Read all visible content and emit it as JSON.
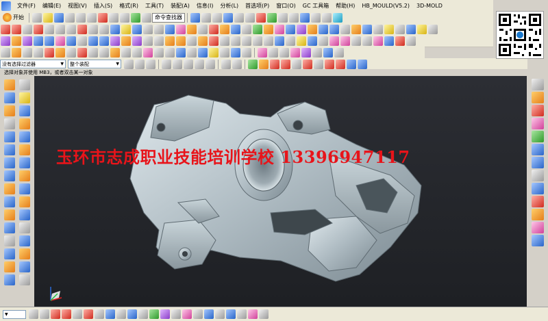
{
  "menu": {
    "items": [
      "文件(F)",
      "编辑(E)",
      "视图(V)",
      "插入(S)",
      "格式(R)",
      "工具(T)",
      "装配(A)",
      "信息(I)",
      "分析(L)",
      "首选项(P)",
      "窗口(O)",
      "GC 工具箱",
      "帮助(H)",
      "HB_MOULD(V5.2)",
      "3D-MOLD"
    ]
  },
  "toolbar": {
    "start_label": "开始",
    "command_finder_label": "命令查找器"
  },
  "selection": {
    "filter_value": "没有选择过滤器",
    "assembly_value": "整个装配"
  },
  "status": {
    "prompt": "选择对象并使用 MB3，或者双击某一对象"
  },
  "watermark": {
    "text": "玉环市志成职业技能培训学校 13396947117"
  },
  "colors": {
    "viewport_bg": "#26282d",
    "watermark": "#e8141a",
    "part": "#b8c6cc"
  },
  "icons": {
    "qr": "qr-code-icon",
    "triad": "wcs-triad-icon"
  }
}
